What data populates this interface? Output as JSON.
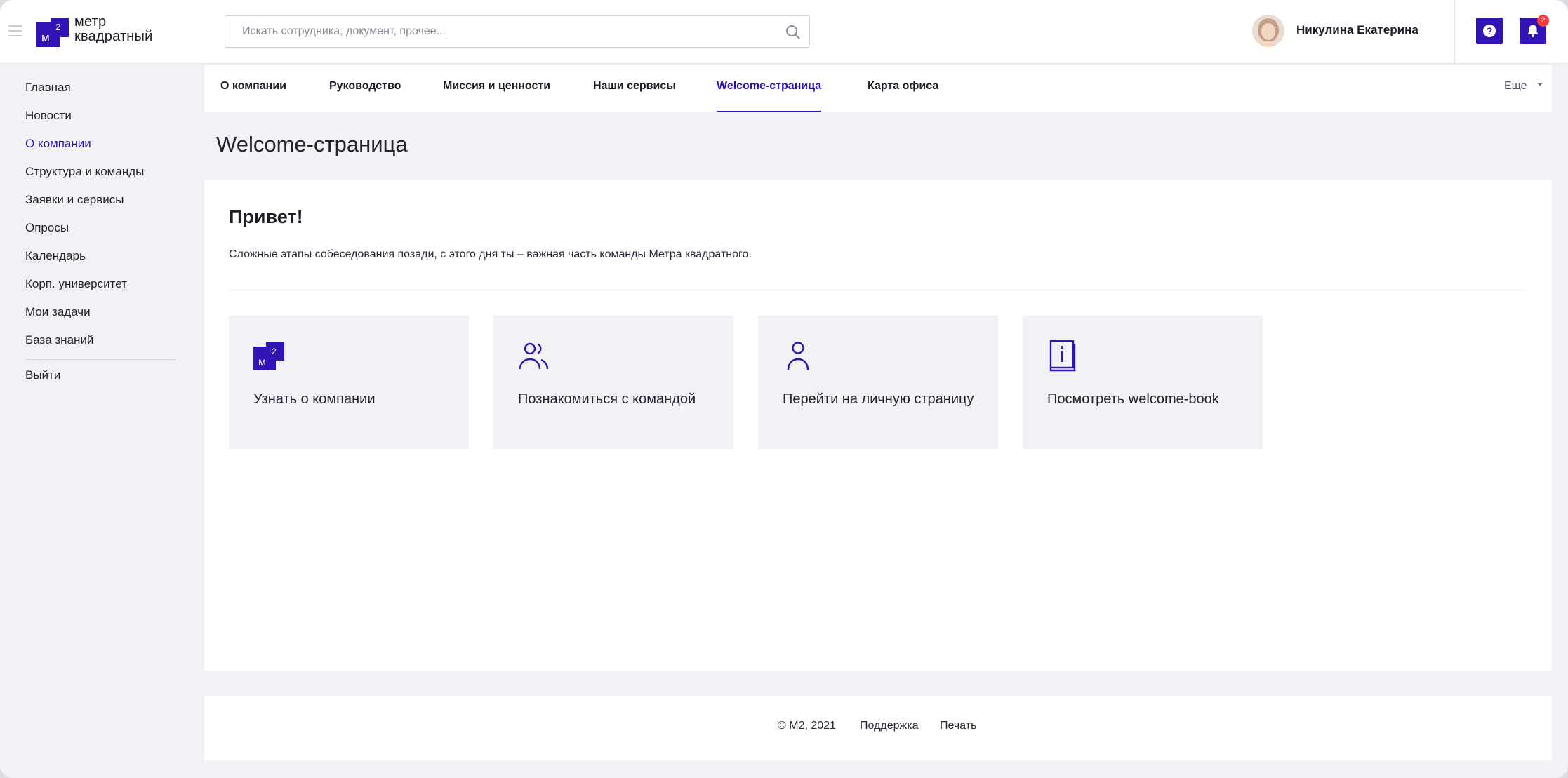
{
  "header": {
    "logo_line1": "метр",
    "logo_line2": "квадратный",
    "logo_mark_text": "м",
    "logo_mark_sup": "2",
    "search_placeholder": "Искать сотрудника, документ, прочее...",
    "user_name": "Никулина Екатерина",
    "notifications_count": "2",
    "icons": [
      "menu-icon",
      "search-icon",
      "help-icon",
      "bell-icon"
    ]
  },
  "sidebar": {
    "items": [
      {
        "label": "Главная",
        "active": false
      },
      {
        "label": "Новости",
        "active": false
      },
      {
        "label": "О компании",
        "active": true
      },
      {
        "label": "Структура и команды",
        "active": false
      },
      {
        "label": "Заявки и сервисы",
        "active": false
      },
      {
        "label": "Опросы",
        "active": false
      },
      {
        "label": "Календарь",
        "active": false
      },
      {
        "label": "Корп. университет",
        "active": false
      },
      {
        "label": "Мои задачи",
        "active": false
      },
      {
        "label": "База знаний",
        "active": false
      }
    ],
    "logout": "Выйти"
  },
  "tabs": {
    "items": [
      {
        "label": "О компании",
        "active": false
      },
      {
        "label": "Руководство",
        "active": false
      },
      {
        "label": "Миссия и ценности",
        "active": false
      },
      {
        "label": "Наши сервисы",
        "active": false
      },
      {
        "label": "Welcome-страница",
        "active": true
      },
      {
        "label": "Карта офиса",
        "active": false
      }
    ],
    "more": "Еще"
  },
  "page": {
    "title": "Welcome-страница",
    "greeting": "Привет!",
    "intro": "Сложные этапы собеседования позади, с этого дня ты – важная часть команды Метра квадратного.",
    "tiles": [
      {
        "label": "Узнать о компании",
        "icon": "company-logo-icon"
      },
      {
        "label": "Познакомиться с командой",
        "icon": "team-icon"
      },
      {
        "label": "Перейти на личную страницу",
        "icon": "user-icon"
      },
      {
        "label": "Посмотреть welcome-book",
        "icon": "book-info-icon"
      }
    ]
  },
  "footer": {
    "copyright": "© М2, 2021",
    "support": "Поддержка",
    "print": "Печать"
  },
  "colors": {
    "accent": "#3213b5",
    "badge": "#ff3b3b",
    "background": "#f1f1f6"
  }
}
